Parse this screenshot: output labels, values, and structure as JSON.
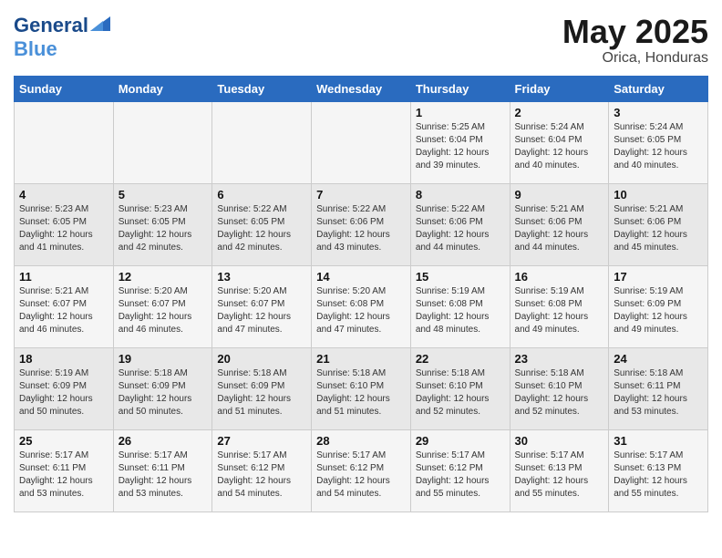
{
  "header": {
    "logo_line1": "General",
    "logo_line2": "Blue",
    "month_year": "May 2025",
    "location": "Orica, Honduras"
  },
  "weekdays": [
    "Sunday",
    "Monday",
    "Tuesday",
    "Wednesday",
    "Thursday",
    "Friday",
    "Saturday"
  ],
  "weeks": [
    [
      {
        "day": "",
        "detail": ""
      },
      {
        "day": "",
        "detail": ""
      },
      {
        "day": "",
        "detail": ""
      },
      {
        "day": "",
        "detail": ""
      },
      {
        "day": "1",
        "detail": "Sunrise: 5:25 AM\nSunset: 6:04 PM\nDaylight: 12 hours\nand 39 minutes."
      },
      {
        "day": "2",
        "detail": "Sunrise: 5:24 AM\nSunset: 6:04 PM\nDaylight: 12 hours\nand 40 minutes."
      },
      {
        "day": "3",
        "detail": "Sunrise: 5:24 AM\nSunset: 6:05 PM\nDaylight: 12 hours\nand 40 minutes."
      }
    ],
    [
      {
        "day": "4",
        "detail": "Sunrise: 5:23 AM\nSunset: 6:05 PM\nDaylight: 12 hours\nand 41 minutes."
      },
      {
        "day": "5",
        "detail": "Sunrise: 5:23 AM\nSunset: 6:05 PM\nDaylight: 12 hours\nand 42 minutes."
      },
      {
        "day": "6",
        "detail": "Sunrise: 5:22 AM\nSunset: 6:05 PM\nDaylight: 12 hours\nand 42 minutes."
      },
      {
        "day": "7",
        "detail": "Sunrise: 5:22 AM\nSunset: 6:06 PM\nDaylight: 12 hours\nand 43 minutes."
      },
      {
        "day": "8",
        "detail": "Sunrise: 5:22 AM\nSunset: 6:06 PM\nDaylight: 12 hours\nand 44 minutes."
      },
      {
        "day": "9",
        "detail": "Sunrise: 5:21 AM\nSunset: 6:06 PM\nDaylight: 12 hours\nand 44 minutes."
      },
      {
        "day": "10",
        "detail": "Sunrise: 5:21 AM\nSunset: 6:06 PM\nDaylight: 12 hours\nand 45 minutes."
      }
    ],
    [
      {
        "day": "11",
        "detail": "Sunrise: 5:21 AM\nSunset: 6:07 PM\nDaylight: 12 hours\nand 46 minutes."
      },
      {
        "day": "12",
        "detail": "Sunrise: 5:20 AM\nSunset: 6:07 PM\nDaylight: 12 hours\nand 46 minutes."
      },
      {
        "day": "13",
        "detail": "Sunrise: 5:20 AM\nSunset: 6:07 PM\nDaylight: 12 hours\nand 47 minutes."
      },
      {
        "day": "14",
        "detail": "Sunrise: 5:20 AM\nSunset: 6:08 PM\nDaylight: 12 hours\nand 47 minutes."
      },
      {
        "day": "15",
        "detail": "Sunrise: 5:19 AM\nSunset: 6:08 PM\nDaylight: 12 hours\nand 48 minutes."
      },
      {
        "day": "16",
        "detail": "Sunrise: 5:19 AM\nSunset: 6:08 PM\nDaylight: 12 hours\nand 49 minutes."
      },
      {
        "day": "17",
        "detail": "Sunrise: 5:19 AM\nSunset: 6:09 PM\nDaylight: 12 hours\nand 49 minutes."
      }
    ],
    [
      {
        "day": "18",
        "detail": "Sunrise: 5:19 AM\nSunset: 6:09 PM\nDaylight: 12 hours\nand 50 minutes."
      },
      {
        "day": "19",
        "detail": "Sunrise: 5:18 AM\nSunset: 6:09 PM\nDaylight: 12 hours\nand 50 minutes."
      },
      {
        "day": "20",
        "detail": "Sunrise: 5:18 AM\nSunset: 6:09 PM\nDaylight: 12 hours\nand 51 minutes."
      },
      {
        "day": "21",
        "detail": "Sunrise: 5:18 AM\nSunset: 6:10 PM\nDaylight: 12 hours\nand 51 minutes."
      },
      {
        "day": "22",
        "detail": "Sunrise: 5:18 AM\nSunset: 6:10 PM\nDaylight: 12 hours\nand 52 minutes."
      },
      {
        "day": "23",
        "detail": "Sunrise: 5:18 AM\nSunset: 6:10 PM\nDaylight: 12 hours\nand 52 minutes."
      },
      {
        "day": "24",
        "detail": "Sunrise: 5:18 AM\nSunset: 6:11 PM\nDaylight: 12 hours\nand 53 minutes."
      }
    ],
    [
      {
        "day": "25",
        "detail": "Sunrise: 5:17 AM\nSunset: 6:11 PM\nDaylight: 12 hours\nand 53 minutes."
      },
      {
        "day": "26",
        "detail": "Sunrise: 5:17 AM\nSunset: 6:11 PM\nDaylight: 12 hours\nand 53 minutes."
      },
      {
        "day": "27",
        "detail": "Sunrise: 5:17 AM\nSunset: 6:12 PM\nDaylight: 12 hours\nand 54 minutes."
      },
      {
        "day": "28",
        "detail": "Sunrise: 5:17 AM\nSunset: 6:12 PM\nDaylight: 12 hours\nand 54 minutes."
      },
      {
        "day": "29",
        "detail": "Sunrise: 5:17 AM\nSunset: 6:12 PM\nDaylight: 12 hours\nand 55 minutes."
      },
      {
        "day": "30",
        "detail": "Sunrise: 5:17 AM\nSunset: 6:13 PM\nDaylight: 12 hours\nand 55 minutes."
      },
      {
        "day": "31",
        "detail": "Sunrise: 5:17 AM\nSunset: 6:13 PM\nDaylight: 12 hours\nand 55 minutes."
      }
    ]
  ]
}
